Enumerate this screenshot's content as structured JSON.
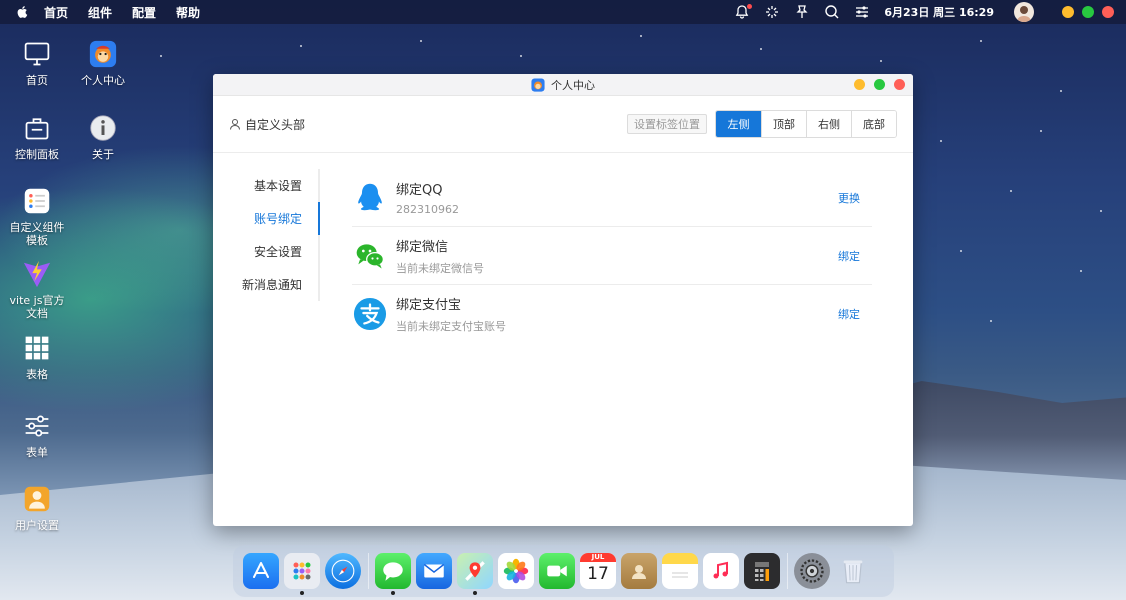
{
  "menubar": {
    "items": [
      "首页",
      "组件",
      "配置",
      "帮助"
    ],
    "clock": "6月23日 周三 16:29"
  },
  "desktop": {
    "icons": [
      {
        "label": "首页",
        "icon": "monitor-icon"
      },
      {
        "label": "个人中心",
        "icon": "monkey-avatar-icon"
      },
      {
        "label": "控制面板",
        "icon": "toolbox-icon"
      },
      {
        "label": "关于",
        "icon": "info-icon"
      },
      {
        "label": "自定义组件模板",
        "icon": "list-card-icon"
      },
      {
        "label": "vite js官方文档",
        "icon": "vite-logo-icon"
      },
      {
        "label": "表格",
        "icon": "grid-icon"
      },
      {
        "label": "表单",
        "icon": "sliders-icon"
      },
      {
        "label": "用户设置",
        "icon": "user-settings-icon"
      }
    ]
  },
  "window": {
    "title": "个人中心",
    "header": {
      "left_label": "自定义头部",
      "tag_position_label": "设置标签位置",
      "position_options": [
        "左侧",
        "顶部",
        "右侧",
        "底部"
      ],
      "active_position": "左侧"
    },
    "nav": {
      "items": [
        "基本设置",
        "账号绑定",
        "安全设置",
        "新消息通知"
      ],
      "active": "账号绑定"
    },
    "accounts": [
      {
        "title": "绑定QQ",
        "subtitle": "282310962",
        "action": "更换",
        "icon": "qq-icon",
        "color": "#1b8ff0"
      },
      {
        "title": "绑定微信",
        "subtitle": "当前未绑定微信号",
        "action": "绑定",
        "icon": "wechat-icon",
        "color": "#2bb52b"
      },
      {
        "title": "绑定支付宝",
        "subtitle": "当前未绑定支付宝账号",
        "action": "绑定",
        "icon": "alipay-icon",
        "color": "#1a9be6"
      }
    ]
  },
  "dock": {
    "calendar_month": "JUL",
    "calendar_day": "17"
  },
  "colors": {
    "accent": "#1677d9",
    "traffic_red": "#ff5f57",
    "traffic_yellow": "#febc2e",
    "traffic_green": "#28c840"
  }
}
